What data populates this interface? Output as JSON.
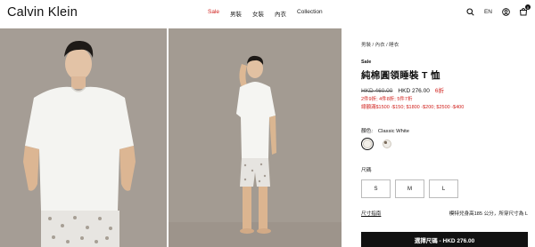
{
  "header": {
    "logo": "Calvin Klein",
    "nav": [
      "Sale",
      "男裝",
      "女裝",
      "內衣",
      "Collection"
    ],
    "language": "EN",
    "cart_count": "0",
    "icons": [
      "search-icon",
      "user-icon",
      "cart-icon"
    ]
  },
  "product": {
    "breadcrumbs": [
      "男裝",
      "內衣",
      "睡衣"
    ],
    "sale_label": "Sale",
    "title": "純棉圓領睡裝 T 恤",
    "old_price": "HKD 460.00",
    "new_price": "HKD 276.00",
    "discount": "6折",
    "promo_line1": "2件9折; 4件8折; 5件7折",
    "promo_line2": "總額滿$1500 -$150; $1800 -$200; $2500 -$400",
    "color_label": "顏色:",
    "color_value": "Classic White",
    "size_label": "尺碼",
    "sizes": [
      "S",
      "M",
      "L"
    ],
    "size_guide": "尺寸指南",
    "model_info": "模特兒身高185 公分，所穿尺寸為 L",
    "select_button": "選擇尺碼 - HKD 276.00"
  },
  "colors": {
    "sale": "#d0201c",
    "photo_bg": "#a39b93",
    "button_bg": "#111111"
  }
}
